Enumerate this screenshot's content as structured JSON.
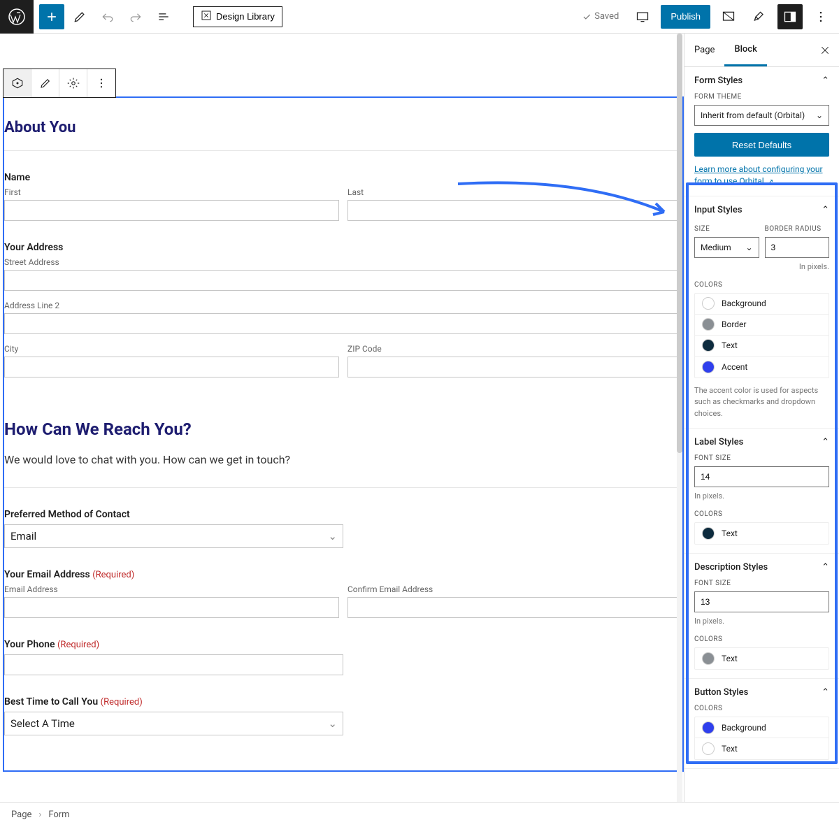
{
  "topbar": {
    "design_library": "Design Library",
    "saved": "Saved",
    "publish": "Publish"
  },
  "block_toolbar": {},
  "form": {
    "section1_title": "About You",
    "name_label": "Name",
    "name_first": "First",
    "name_last": "Last",
    "address_label": "Your Address",
    "addr_street": "Street Address",
    "addr_line2": "Address Line 2",
    "addr_city": "City",
    "addr_zip": "ZIP Code",
    "section2_title": "How Can We Reach You?",
    "section2_desc": "We would love to chat with you. How can we get in touch?",
    "contact_method_label": "Preferred Method of Contact",
    "contact_method_value": "Email",
    "email_label": "Your Email Address",
    "required": "(Required)",
    "email_addr": "Email Address",
    "email_confirm": "Confirm Email Address",
    "phone_label": "Your Phone",
    "besttime_label": "Best Time to Call You",
    "besttime_value": "Select A Time"
  },
  "sidebar": {
    "tabs": {
      "page": "Page",
      "block": "Block"
    },
    "form_styles": {
      "title": "Form Styles",
      "theme_label": "FORM THEME",
      "theme_value": "Inherit from default (Orbital)",
      "reset": "Reset Defaults",
      "learn_more": "Learn more about configuring your form to use Orbital."
    },
    "input_styles": {
      "title": "Input Styles",
      "size_label": "SIZE",
      "size_value": "Medium",
      "radius_label": "BORDER RADIUS",
      "radius_value": "3",
      "radius_hint": "In pixels.",
      "colors_label": "COLORS",
      "colors": [
        {
          "name": "Background",
          "hex": "#ffffff"
        },
        {
          "name": "Border",
          "hex": "#8a8f94"
        },
        {
          "name": "Text",
          "hex": "#0d2b3e"
        },
        {
          "name": "Accent",
          "hex": "#2f3fed"
        }
      ],
      "accent_note": "The accent color is used for aspects such as checkmarks and dropdown choices."
    },
    "label_styles": {
      "title": "Label Styles",
      "fontsize_label": "FONT SIZE",
      "fontsize_value": "14",
      "hint": "In pixels.",
      "colors_label": "COLORS",
      "colors": [
        {
          "name": "Text",
          "hex": "#0d2b3e"
        }
      ]
    },
    "desc_styles": {
      "title": "Description Styles",
      "fontsize_label": "FONT SIZE",
      "fontsize_value": "13",
      "hint": "In pixels.",
      "colors_label": "COLORS",
      "colors": [
        {
          "name": "Text",
          "hex": "#8a8f94"
        }
      ]
    },
    "button_styles": {
      "title": "Button Styles",
      "colors_label": "COLORS",
      "colors": [
        {
          "name": "Background",
          "hex": "#2f3fed"
        },
        {
          "name": "Text",
          "hex": "#ffffff"
        }
      ]
    }
  },
  "breadcrumb": {
    "c1": "Page",
    "c2": "Form"
  }
}
